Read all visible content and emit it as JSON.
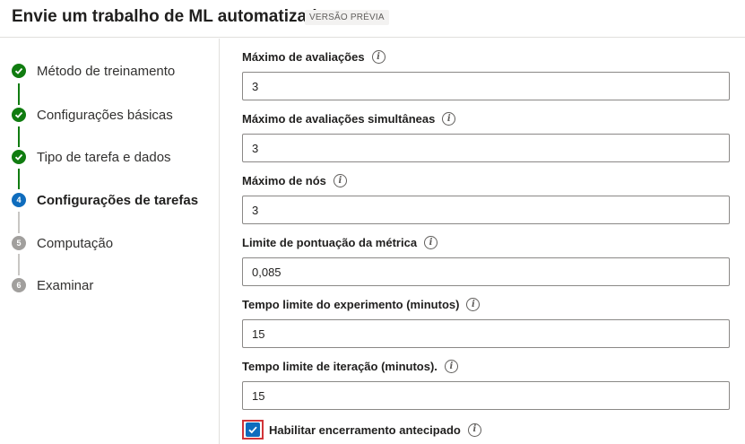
{
  "header": {
    "title": "Envie um trabalho de ML automatizado",
    "badge": "VERSÃO PRÉVIA"
  },
  "sidebar": {
    "steps": [
      {
        "label": "Método de treinamento",
        "status": "done",
        "marker": "check-icon"
      },
      {
        "label": "Configurações básicas",
        "status": "done",
        "marker": "check-icon"
      },
      {
        "label": "Tipo de tarefa e dados",
        "status": "done",
        "marker": "check-icon"
      },
      {
        "label": "Configurações de tarefas",
        "status": "current",
        "number": "4"
      },
      {
        "label": "Computação",
        "status": "pending",
        "number": "5"
      },
      {
        "label": "Examinar",
        "status": "pending",
        "number": "6"
      }
    ]
  },
  "form": {
    "max_trials": {
      "label": "Máximo de avaliações",
      "value": "3"
    },
    "max_concurrent_trials": {
      "label": "Máximo de avaliações simultâneas",
      "value": "3"
    },
    "max_nodes": {
      "label": "Máximo de nós",
      "value": "3"
    },
    "metric_threshold": {
      "label": "Limite de pontuação da métrica",
      "value": "0,085"
    },
    "experiment_timeout": {
      "label": "Tempo limite do experimento (minutos)",
      "value": "15"
    },
    "iteration_timeout": {
      "label": "Tempo limite de iteração (minutos).",
      "value": "15"
    },
    "early_termination": {
      "label": "Habilitar encerramento antecipado",
      "checked": true
    }
  },
  "colors": {
    "done": "#107c10",
    "current": "#0f6cbd",
    "pending": "#a19f9d",
    "highlight": "#d13438"
  }
}
